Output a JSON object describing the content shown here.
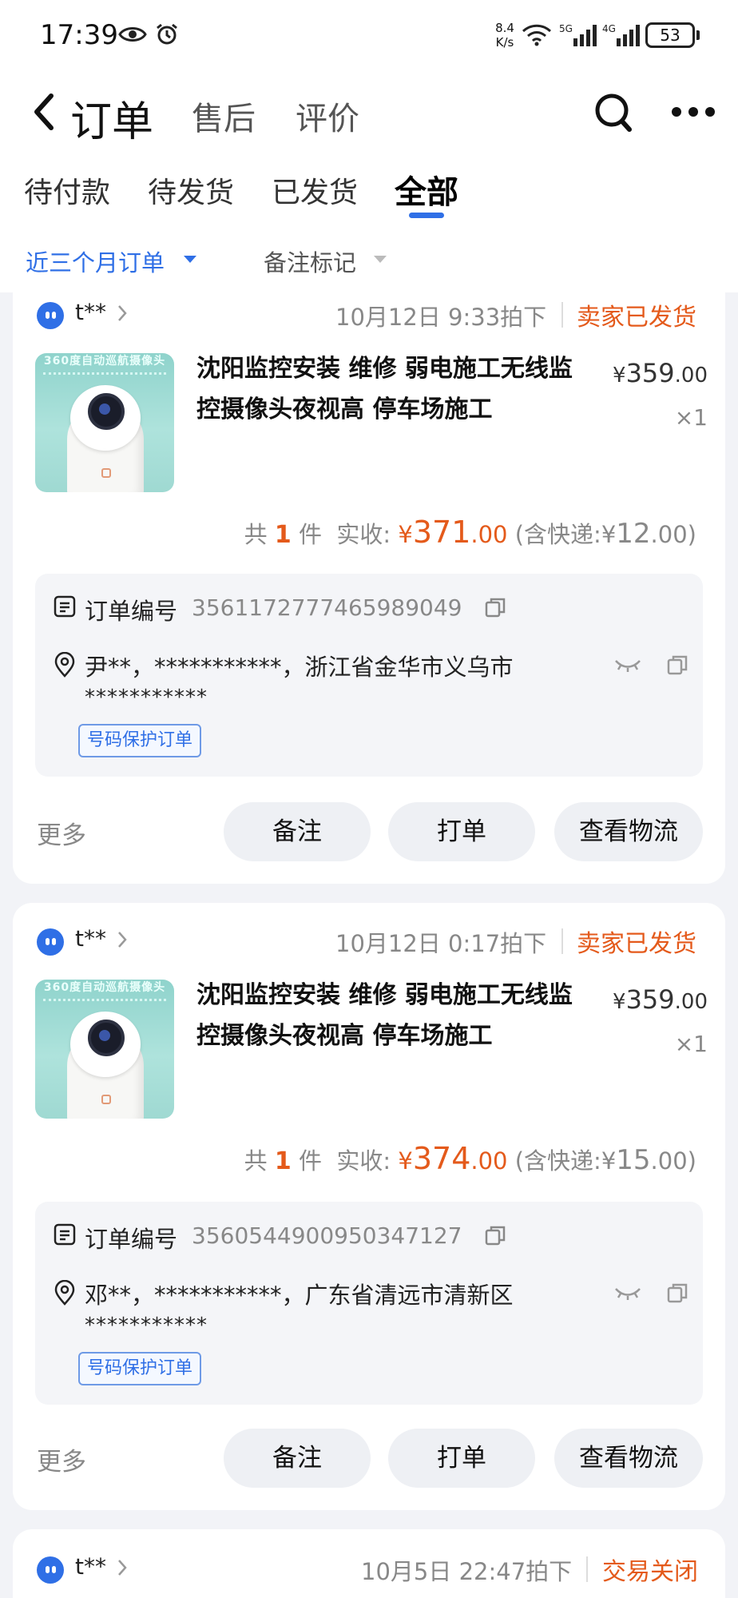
{
  "status_bar": {
    "time": "17:39",
    "speed_value": "8.4",
    "speed_unit": "K/s",
    "net1": "5G",
    "net2": "4G",
    "battery": "53",
    "icons": [
      "eye-icon",
      "alarm-icon",
      "wifi-icon",
      "signal-icon",
      "battery-icon"
    ]
  },
  "nav": {
    "title": "订单",
    "tabs": [
      "售后",
      "评价"
    ]
  },
  "tabs": {
    "items": [
      "待付款",
      "待发货",
      "已发货",
      "全部"
    ],
    "active": "全部"
  },
  "filters": {
    "period": "近三个月订单",
    "remark": "备注标记"
  },
  "colors": {
    "accent_blue": "#2f6fe6",
    "status_orange": "#e45a1b",
    "background": "#f2f3f7"
  },
  "orders": [
    {
      "shop": "t**",
      "time": "10月12日 9:33拍下",
      "status": "卖家已发货",
      "product": {
        "title": "沈阳监控安装 维修  弱电施工无线监控摄像头夜视高 停车场施工",
        "image_banner": "360度自动巡航摄像头",
        "price_int": "359",
        "price_dec": ".00",
        "qty": "×1"
      },
      "summary": {
        "prefix": "共",
        "count": "1",
        "unit": "件",
        "paid_label": "实收:",
        "paid_int": "371",
        "paid_dec": ".00",
        "ship_prefix": "(含快递:",
        "ship_int": "12",
        "ship_dec": ".00",
        "ship_suffix": ")"
      },
      "order_no_label": "订单编号",
      "order_no": "3561172777465989049",
      "address": "尹**，***********，浙江省金华市义乌市",
      "address_detail": "***********",
      "protect_tag": "号码保护订单",
      "actions": {
        "more": "更多",
        "note": "备注",
        "print": "打单",
        "logistics": "查看物流"
      }
    },
    {
      "shop": "t**",
      "time": "10月12日 0:17拍下",
      "status": "卖家已发货",
      "product": {
        "title": "沈阳监控安装 维修  弱电施工无线监控摄像头夜视高 停车场施工",
        "image_banner": "360度自动巡航摄像头",
        "price_int": "359",
        "price_dec": ".00",
        "qty": "×1"
      },
      "summary": {
        "prefix": "共",
        "count": "1",
        "unit": "件",
        "paid_label": "实收:",
        "paid_int": "374",
        "paid_dec": ".00",
        "ship_prefix": "(含快递:",
        "ship_int": "15",
        "ship_dec": ".00",
        "ship_suffix": ")"
      },
      "order_no_label": "订单编号",
      "order_no": "3560544900950347127",
      "address": "邓**，***********，广东省清远市清新区",
      "address_detail": "***********",
      "protect_tag": "号码保护订单",
      "actions": {
        "more": "更多",
        "note": "备注",
        "print": "打单",
        "logistics": "查看物流"
      }
    },
    {
      "shop": "t**",
      "time": "10月5日 22:47拍下",
      "status": "交易关闭"
    }
  ]
}
